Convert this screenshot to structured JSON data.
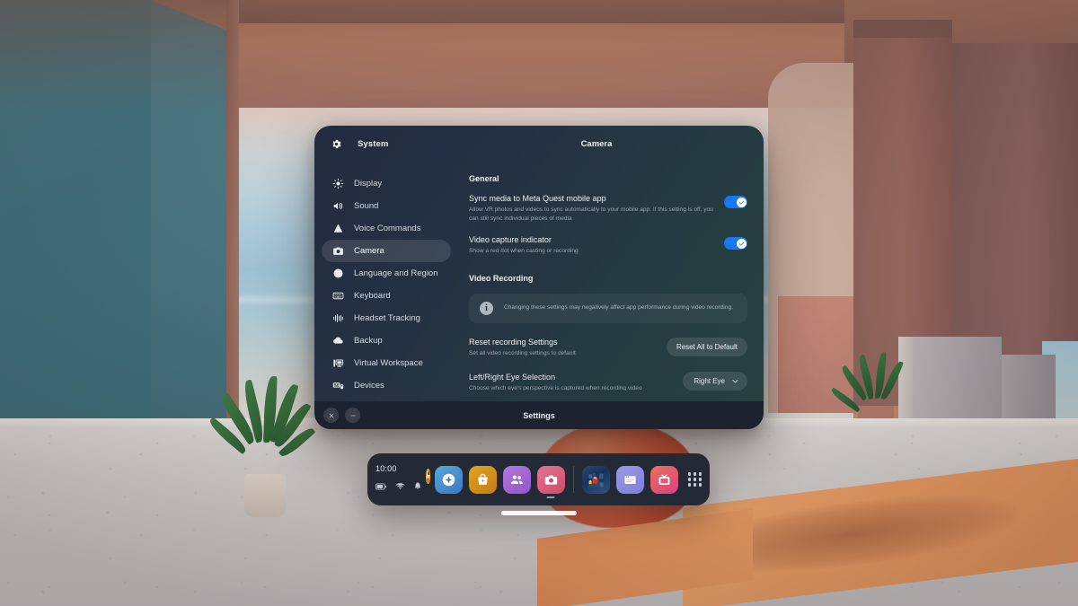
{
  "window": {
    "header": {
      "app_icon": "gear-icon",
      "system_label": "System",
      "page_title": "Camera"
    },
    "taskbar": {
      "close_label": "close-icon",
      "minimize_label": "minimize-icon",
      "title": "Settings"
    }
  },
  "sidebar": {
    "items": [
      {
        "icon": "brightness-icon",
        "label": "Display",
        "active": false
      },
      {
        "icon": "speaker-icon",
        "label": "Sound",
        "active": false
      },
      {
        "icon": "voice-command-icon",
        "label": "Voice Commands",
        "active": false
      },
      {
        "icon": "camera-icon",
        "label": "Camera",
        "active": true
      },
      {
        "icon": "globe-icon",
        "label": "Language and Region",
        "active": false
      },
      {
        "icon": "keyboard-icon",
        "label": "Keyboard",
        "active": false
      },
      {
        "icon": "headset-tracking-icon",
        "label": "Headset Tracking",
        "active": false
      },
      {
        "icon": "cloud-icon",
        "label": "Backup",
        "active": false
      },
      {
        "icon": "workspace-icon",
        "label": "Virtual Workspace",
        "active": false
      },
      {
        "icon": "devices-icon",
        "label": "Devices",
        "active": false
      }
    ]
  },
  "content": {
    "general_heading": "General",
    "sync_media": {
      "title": "Sync media to Meta Quest mobile app",
      "subtitle": "Allow VR photos and videos to sync automatically to your mobile app. If this setting is off, you can still sync individual pieces of media",
      "toggle_state": "on"
    },
    "capture_indicator": {
      "title": "Video capture indicator",
      "subtitle": "Show a red dot when casting or recording",
      "toggle_state": "on"
    },
    "video_recording_heading": "Video Recording",
    "info_banner": {
      "icon": "info-icon",
      "text": "Changing these settings may negatively affect app performance during video recording."
    },
    "reset_recording": {
      "title": "Reset recording Settings",
      "subtitle": "Set all video recording settings to default",
      "button_label": "Reset All to Default"
    },
    "eye_selection": {
      "title": "Left/Right Eye Selection",
      "subtitle": "Choose which eye's perspective is captured when recording video",
      "selected_value": "Right Eye"
    }
  },
  "dock": {
    "time": "10:00",
    "status_icons": [
      "battery-icon",
      "wifi-icon",
      "bell-icon"
    ],
    "avatar": "user-avatar",
    "apps": [
      {
        "name": "explore-app",
        "icon": "compass-icon",
        "running": false
      },
      {
        "name": "store-app",
        "icon": "shopping-bag-icon",
        "running": false
      },
      {
        "name": "people-app",
        "icon": "people-icon",
        "running": false
      },
      {
        "name": "camera-app",
        "icon": "camera-icon",
        "running": true
      },
      {
        "name": "among-us-game",
        "icon": "game-thumbnail",
        "running": false
      },
      {
        "name": "browser-app",
        "icon": "browser-window-icon",
        "running": false
      },
      {
        "name": "tv-app",
        "icon": "television-icon",
        "running": false
      }
    ],
    "app_grid_label": "app-library-grid"
  },
  "colors": {
    "accent_blue": "#1877f2",
    "panel_dark": "#232b3e",
    "dock_dark": "#232a36",
    "taskbar_dark": "#1c222e"
  }
}
